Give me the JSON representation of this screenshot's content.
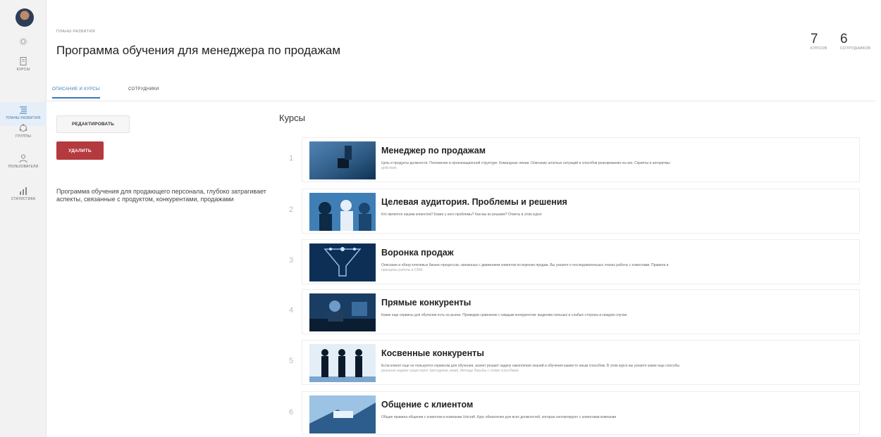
{
  "sidebar": {
    "items": [
      {
        "label": "КУРСЫ",
        "icon": "course-book-icon"
      },
      {
        "label": "ПЛАНЫ РАЗВИТИЯ",
        "icon": "development-plan-icon"
      },
      {
        "label": "ГРУППЫ",
        "icon": "groups-icon"
      },
      {
        "label": "ПОЛЬЗОВАТЕЛИ",
        "icon": "users-icon"
      },
      {
        "label": "СТАТИСТИКА",
        "icon": "statistics-icon"
      }
    ]
  },
  "header": {
    "breadcrumb": "ПЛАНЫ РАЗВИТИЯ",
    "title": "Программа обучения для менеджера по продажам",
    "stats": [
      {
        "value": "7",
        "caption": "КУРСОВ"
      },
      {
        "value": "6",
        "caption": "СОТРУДНИКОВ"
      }
    ]
  },
  "tabs": [
    {
      "label": "ОПИСАНИЕ И КУРСЫ",
      "active": true
    },
    {
      "label": "СОТРУДНИКИ",
      "active": false
    }
  ],
  "actions": {
    "edit_label": "РЕДАКТИРОВАТЬ",
    "delete_label": "УДАЛИТЬ"
  },
  "description": "Программа обучения для продающего персонала, глубоко затрагивает аспекты, связанные с продуктом, конкурентами, продажами",
  "courses_title": "Курсы",
  "courses": [
    {
      "index": "1",
      "title": "Менеджер по продажам",
      "desc1": "Цель и продукты должности. Положение в организационной структуре. Командные линии. Описание штатных ситуаций и способов реагирования на них. Скрипты и алгоритмы",
      "desc2": "действия."
    },
    {
      "index": "2",
      "title": "Целевая аудитория. Проблемы и решения",
      "desc1": "Кто является нашим клиентом? Какие у него проблемы? Как мы их решаем? Ответы в этом курсе",
      "desc2": ""
    },
    {
      "index": "3",
      "title": "Воронка продаж",
      "desc1": "Описание и обзор ключевых бизнес-процессов, связанных с движением клиентов по воронке продаж. Вы узнаете о последовательных этапах работы с клиентами. Правила и",
      "desc2": "принципы работы в CRM."
    },
    {
      "index": "4",
      "title": "Прямые конкуренты",
      "desc1": "Какие еще сервисы для обучения есть на рынке. Проведем сравнение с каждым конкурентом: выделим сильные и слабые стороны в каждом случае.",
      "desc2": ""
    },
    {
      "index": "5",
      "title": "Косвенные конкуренты",
      "desc1": "Если клиент еще не пользуется сервисом для обучения, значит решает задачу накопления знаний и обучения каким-то иным способом. В этом курсе вы узнаете какие еще способы",
      "desc2": "решения задачи существуют (методички, вики). Методы борьбы с этими способами"
    },
    {
      "index": "6",
      "title": "Общение с клиентом",
      "desc1": "Общие правила общения с клиентом в компании Unicraft. Курс обязателен для всех должностей, которые контактируют с клиентами компании",
      "desc2": ""
    }
  ],
  "colors": {
    "accent": "#3a78b8",
    "danger": "#b53a3e",
    "sidebar_bg": "#f2f2f2"
  }
}
